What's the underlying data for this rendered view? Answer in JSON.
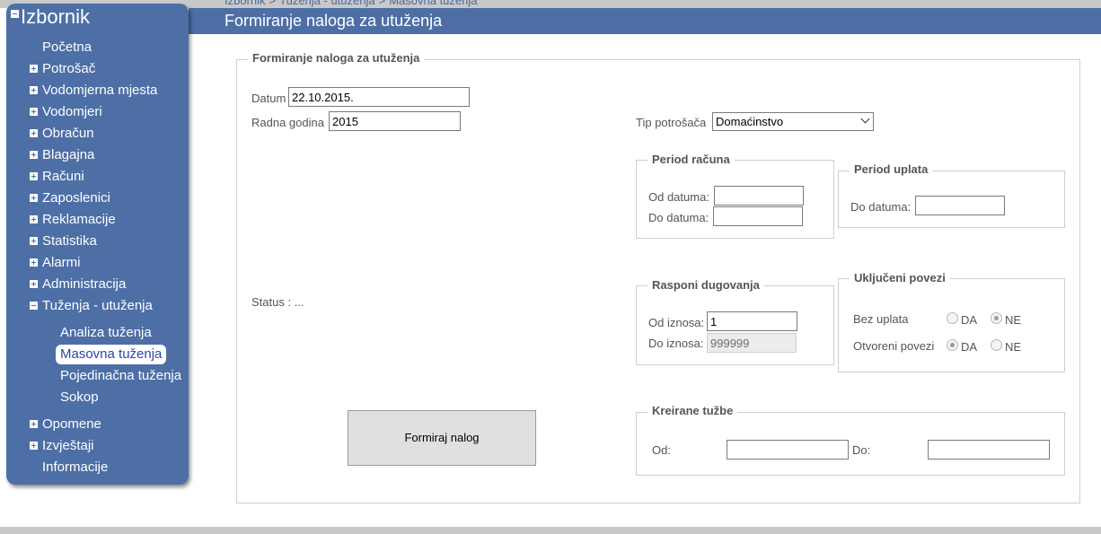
{
  "breadcrumb": {
    "items": [
      "Izbornik",
      ">",
      "Tuženja - utuženja",
      ">",
      "Masovna tuženja"
    ]
  },
  "header": {
    "title": "Formiranje naloga za utuženja"
  },
  "sidebar": {
    "title": "Izbornik",
    "items": [
      {
        "label": "Početna"
      },
      {
        "label": "Potrošač"
      },
      {
        "label": "Vodomjerna mjesta"
      },
      {
        "label": "Vodomjeri"
      },
      {
        "label": "Obračun"
      },
      {
        "label": "Blagajna"
      },
      {
        "label": "Računi"
      },
      {
        "label": "Zaposlenici"
      },
      {
        "label": "Reklamacije"
      },
      {
        "label": "Statistika"
      },
      {
        "label": "Alarmi"
      },
      {
        "label": "Administracija"
      },
      {
        "label": "Tuženja - utuženja"
      },
      {
        "label": "Opomene"
      },
      {
        "label": "Izvještaji"
      },
      {
        "label": "Informacije"
      }
    ],
    "subitems": [
      {
        "label": "Analiza tuženja"
      },
      {
        "label": "Masovna tuženja"
      },
      {
        "label": "Pojedinačna tuženja"
      },
      {
        "label": "Sokop"
      }
    ]
  },
  "form": {
    "legend": "Formiranje naloga za utuženja",
    "datum_label": "Datum",
    "datum_value": "22.10.2015.",
    "radna_godina_label": "Radna godina",
    "radna_godina_value": "2015",
    "tip_potrosaca_label": "Tip potrošača",
    "tip_potrosaca_value": "Domaćinstvo",
    "status_text": "Status : ...",
    "period_racuna": {
      "legend": "Period računa",
      "od_label": "Od datuma:",
      "do_label": "Do datuma:",
      "od_value": "",
      "do_value": ""
    },
    "period_uplata": {
      "legend": "Period uplata",
      "do_label": "Do datuma:",
      "do_value": ""
    },
    "rasponi": {
      "legend": "Rasponi dugovanja",
      "od_label": "Od iznosa:",
      "od_value": "1",
      "do_label": "Do iznosa:",
      "do_value": "999999"
    },
    "ukljuceni": {
      "legend": "Uključeni povezi",
      "bez_uplata_label": "Bez uplata",
      "otvoreni_label": "Otvoreni povezi",
      "da_label": "DA",
      "ne_label": "NE",
      "bez_uplata_selected": "NE",
      "otvoreni_selected": "DA"
    },
    "kreirane": {
      "legend": "Kreirane tužbe",
      "od_label": "Od:",
      "do_label": "Do:",
      "od_value": "",
      "do_value": ""
    },
    "submit_label": "Formiraj nalog"
  },
  "colors": {
    "header": "#4d6fa6",
    "sidebar": "#4d6fa6",
    "active_text": "#2a48a8"
  }
}
